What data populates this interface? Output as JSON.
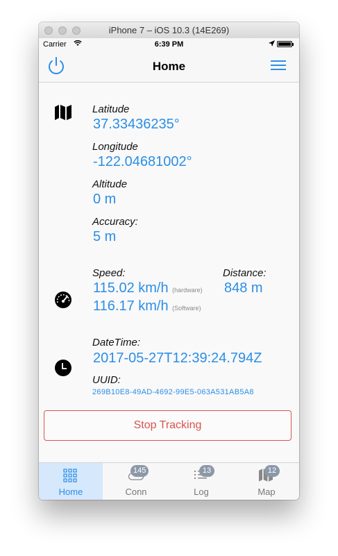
{
  "window": {
    "title": "iPhone 7 – iOS 10.3 (14E269)"
  },
  "status_bar": {
    "carrier": "Carrier",
    "time": "6:39 PM"
  },
  "nav": {
    "title": "Home"
  },
  "location": {
    "latitude_label": "Latitude",
    "latitude_value": "37.33436235°",
    "longitude_label": "Longitude",
    "longitude_value": "-122.04681002°",
    "altitude_label": "Altitude",
    "altitude_value": "0 m",
    "accuracy_label": "Accuracy:",
    "accuracy_value": "5 m"
  },
  "speed": {
    "label": "Speed:",
    "hardware_value": "115.02 km/h",
    "hardware_note": "(hardware)",
    "software_value": "116.17 km/h",
    "software_note": "(Software)"
  },
  "distance": {
    "label": "Distance:",
    "value": "848 m"
  },
  "datetime": {
    "label": "DateTime:",
    "value": "2017-05-27T12:39:24.794Z"
  },
  "uuid": {
    "label": "UUID:",
    "value": "269B10E8-49AD-4692-99E5-063A531AB5A8"
  },
  "actions": {
    "stop_label": "Stop Tracking"
  },
  "tabs": [
    {
      "label": "Home",
      "badge": ""
    },
    {
      "label": "Conn",
      "badge": "145"
    },
    {
      "label": "Log",
      "badge": "13"
    },
    {
      "label": "Map",
      "badge": "12"
    }
  ],
  "colors": {
    "accent": "#2a8ee6",
    "danger": "#d9534f",
    "badge": "#8c98a8",
    "active_tab_bg": "#d6e8fb"
  }
}
